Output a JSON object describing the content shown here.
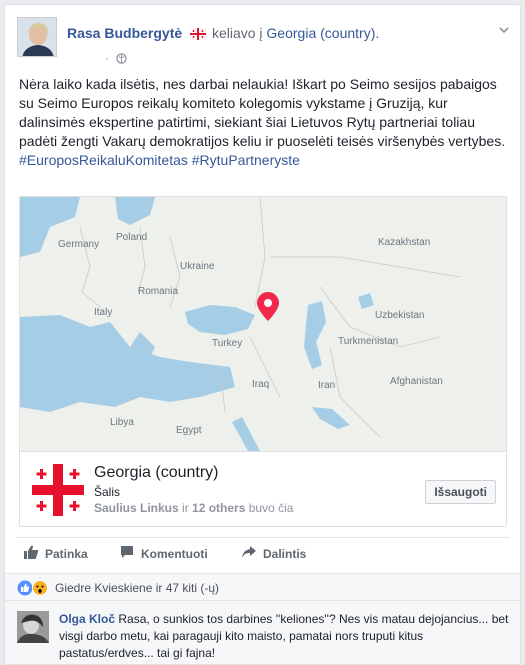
{
  "post": {
    "author": "Rasa Budbergytė",
    "activity": "keliavo į",
    "place_link": "Georgia (country).",
    "body": "Nėra laiko kada ilsėtis, nes darbai nelaukia! Iškart po Seimo sesijos pabaigos su Seimo Europos reikalų komiteto kolegomis vykstame į Gruziją, kur dalinsimės ekspertine patirtimi, siekiant šiai Lietuvos Rytų partneriai toliau padėti žengti Vakarų demokratijos keliu ir puoselėti teisės viršenybės vertybes.",
    "hashtags": "#EuroposReikaluKomitetas #RytuPartneryste",
    "meta_dot": "·",
    "privacy_icon": "globe-icon"
  },
  "map_labels": {
    "germany": "Germany",
    "poland": "Poland",
    "ukraine": "Ukraine",
    "romania": "Romania",
    "kazakhstan": "Kazakhstan",
    "uzbekistan": "Uzbekistan",
    "turkmenistan": "Turkmenistan",
    "turkey": "Turkey",
    "iraq": "Iraq",
    "iran": "Iran",
    "afghanistan": "Afghanistan",
    "libya": "Libya",
    "egypt": "Egypt",
    "italy": "Italy"
  },
  "place_card": {
    "name": "Georgia (country)",
    "type": "Šalis",
    "visitor_name": "Saulius Linkus",
    "visitor_mid": " ir ",
    "visitor_others": "12 others",
    "visitor_suffix": " buvo čia",
    "save_label": "Išsaugoti"
  },
  "actions": {
    "like": "Patinka",
    "comment": "Komentuoti",
    "share": "Dalintis"
  },
  "reactions": {
    "text": "Giedre Kvieskiene ir 47 kiti (-ų)"
  },
  "comment": {
    "author": "Olga Kloč",
    "text": " Rasa, o sunkios tos darbines ''keliones''? Nes vis matau dejojancius... bet visgi darbo metu, kai paragauji kito maisto, pamatai nors truputi kitus pastatus/erdves... tai gi fajna!"
  },
  "colors": {
    "link": "#365899",
    "map_water": "#a5cde6",
    "pin": "#f02849",
    "flag_red": "#e8112d"
  }
}
